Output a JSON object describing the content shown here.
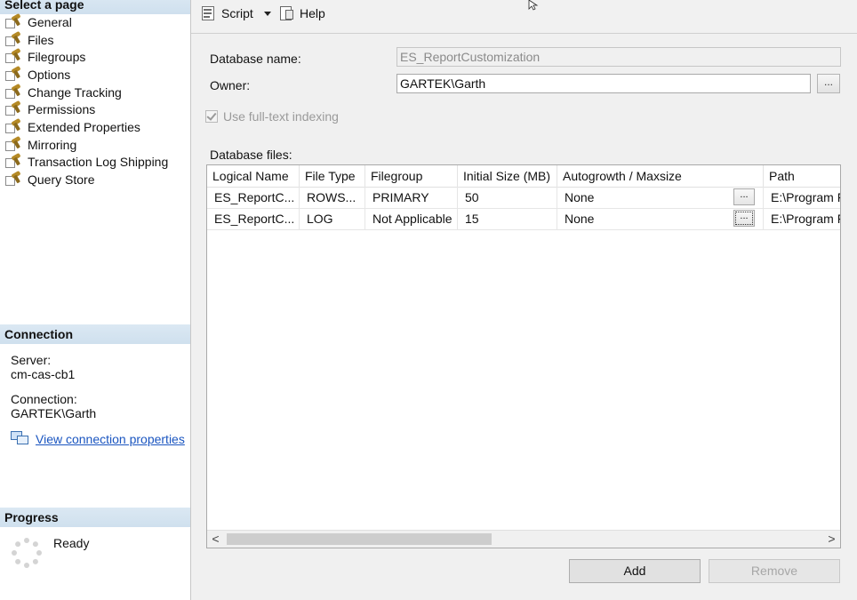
{
  "sidebar": {
    "select_page_header": "Select a page",
    "pages": [
      {
        "label": "General"
      },
      {
        "label": "Files"
      },
      {
        "label": "Filegroups"
      },
      {
        "label": "Options"
      },
      {
        "label": "Change Tracking"
      },
      {
        "label": "Permissions"
      },
      {
        "label": "Extended Properties"
      },
      {
        "label": "Mirroring"
      },
      {
        "label": "Transaction Log Shipping"
      },
      {
        "label": "Query Store"
      }
    ],
    "selected_page": "Files",
    "connection_header": "Connection",
    "server_label": "Server:",
    "server_value": "cm-cas-cb1",
    "connection_label": "Connection:",
    "connection_value": "GARTEK\\Garth",
    "view_connection_link": "View connection properties",
    "progress_header": "Progress",
    "progress_status": "Ready"
  },
  "toolbar": {
    "script_label": "Script",
    "help_label": "Help"
  },
  "form": {
    "database_name_label": "Database name:",
    "database_name_value": "ES_ReportCustomization",
    "owner_label": "Owner:",
    "owner_value": "GARTEK\\Garth",
    "browse_label": "...",
    "fulltext_label": "Use full-text indexing",
    "fulltext_checked": true,
    "database_files_label": "Database files:"
  },
  "grid": {
    "columns": [
      "Logical Name",
      "File Type",
      "Filegroup",
      "Initial Size (MB)",
      "Autogrowth / Maxsize",
      "Path"
    ],
    "rows": [
      {
        "logical_name": "ES_ReportC...",
        "file_type": "ROWS...",
        "filegroup": "PRIMARY",
        "initial_size": "50",
        "autogrowth": "None",
        "button": "...",
        "path": "E:\\Program F"
      },
      {
        "logical_name": "ES_ReportC...",
        "file_type": "LOG",
        "filegroup": "Not Applicable",
        "initial_size": "15",
        "autogrowth": "None",
        "button": "...",
        "path": "E:\\Program F"
      }
    ],
    "scroll_left": "<",
    "scroll_right": ">"
  },
  "buttons": {
    "add_label": "Add",
    "remove_label": "Remove"
  }
}
